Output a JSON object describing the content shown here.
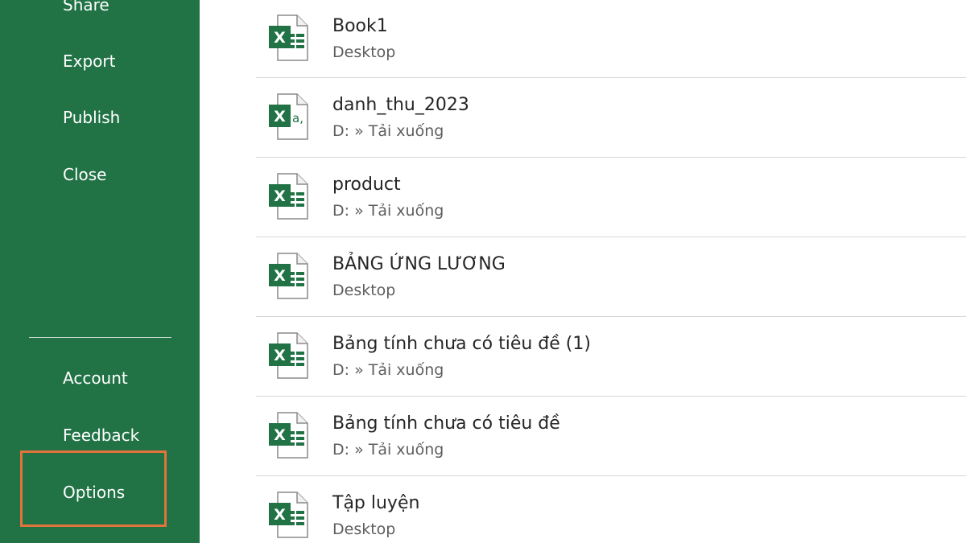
{
  "sidebar": {
    "items": [
      {
        "id": "share",
        "label": "Share"
      },
      {
        "id": "export",
        "label": "Export"
      },
      {
        "id": "publish",
        "label": "Publish"
      },
      {
        "id": "close",
        "label": "Close"
      },
      {
        "id": "account",
        "label": "Account"
      },
      {
        "id": "feedback",
        "label": "Feedback"
      },
      {
        "id": "options",
        "label": "Options"
      }
    ],
    "highlight_color": "#e2733a",
    "background_color": "#217346"
  },
  "recent_files": [
    {
      "name": "Book1",
      "path": "Desktop",
      "icon": "excel-workbook-icon"
    },
    {
      "name": "danh_thu_2023",
      "path": "D: » Tải xuống",
      "icon": "excel-csv-icon"
    },
    {
      "name": "product",
      "path": "D: » Tải xuống",
      "icon": "excel-workbook-icon"
    },
    {
      "name": "BẢNG ỨNG LƯƠNG",
      "path": "Desktop",
      "icon": "excel-workbook-icon"
    },
    {
      "name": "Bảng tính chưa có tiêu đề (1)",
      "path": "D: » Tải xuống",
      "icon": "excel-workbook-icon"
    },
    {
      "name": "Bảng tính chưa có tiêu đề",
      "path": "D: » Tải xuống",
      "icon": "excel-workbook-icon"
    },
    {
      "name": "Tập luyện",
      "path": "Desktop",
      "icon": "excel-workbook-icon"
    }
  ]
}
